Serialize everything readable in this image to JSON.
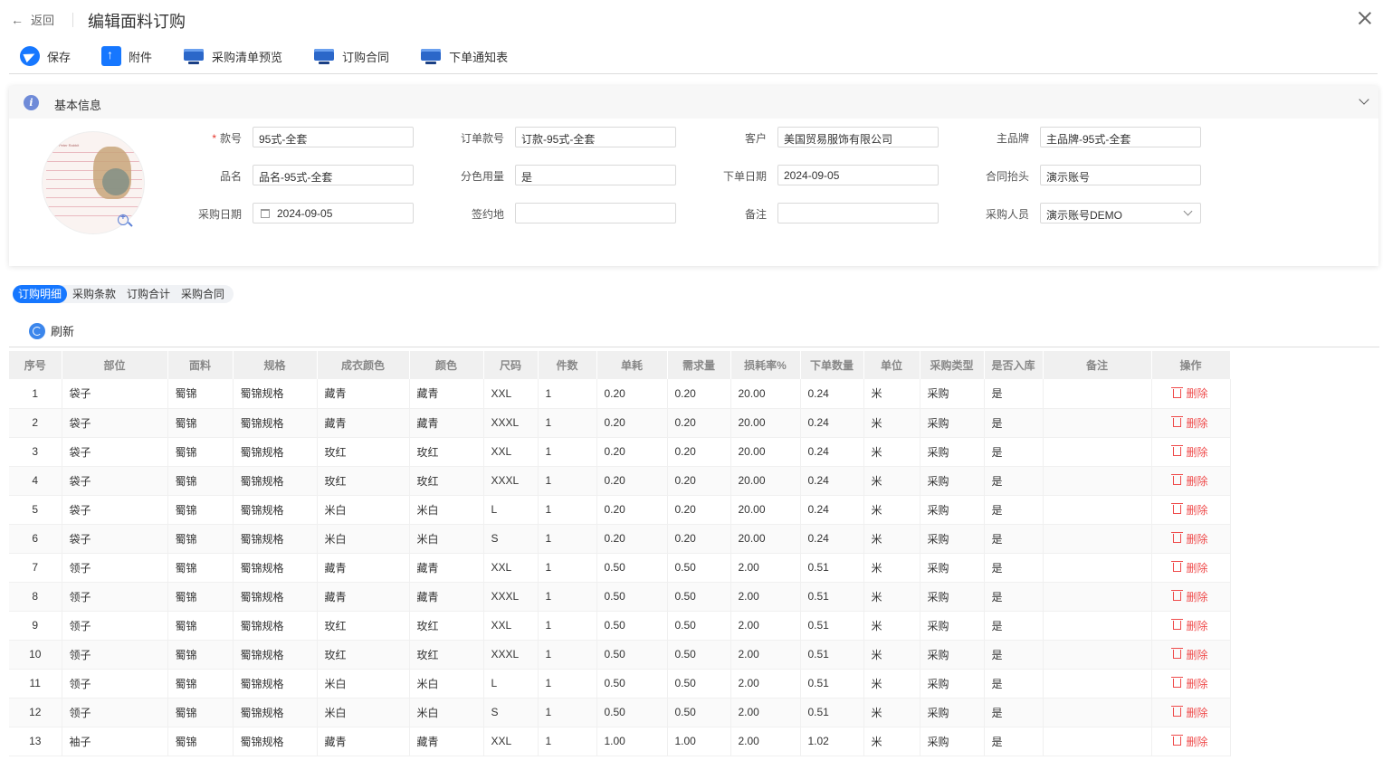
{
  "header": {
    "back_label": "返回",
    "title": "编辑面料订购"
  },
  "toolbar": {
    "save": "保存",
    "attachment": "附件",
    "purchase_list_preview": "采购清单预览",
    "order_contract": "订购合同",
    "order_notice": "下单通知表"
  },
  "panel": {
    "title": "基本信息",
    "thumbnail_text": "Peter Rabbit",
    "fields": {
      "style_no": {
        "label": "款号",
        "value": "95式-全套"
      },
      "order_style_no": {
        "label": "订单款号",
        "value": "订款-95式-全套"
      },
      "customer": {
        "label": "客户",
        "value": "美国贸易服饰有限公司"
      },
      "main_brand": {
        "label": "主品牌",
        "value": "主品牌-95式-全套"
      },
      "product_name": {
        "label": "品名",
        "value": "品名-95式-全套"
      },
      "color_usage": {
        "label": "分色用量",
        "value": "是"
      },
      "order_date": {
        "label": "下单日期",
        "value": "2024-09-05"
      },
      "contract_header": {
        "label": "合同抬头",
        "value": "演示账号"
      },
      "purchase_date": {
        "label": "采购日期",
        "value": "2024-09-05"
      },
      "sign_place": {
        "label": "签约地",
        "value": ""
      },
      "remark": {
        "label": "备注",
        "value": ""
      },
      "buyer": {
        "label": "采购人员",
        "value": "演示账号DEMO"
      }
    }
  },
  "tabs": [
    "订购明细",
    "采购条款",
    "订购合计",
    "采购合同"
  ],
  "refresh_label": "刷新",
  "table": {
    "columns": [
      "序号",
      "部位",
      "面料",
      "规格",
      "成衣颜色",
      "颜色",
      "尺码",
      "件数",
      "单耗",
      "需求量",
      "损耗率%",
      "下单数量",
      "单位",
      "采购类型",
      "是否入库",
      "备注",
      "操作"
    ],
    "delete_label": "删除",
    "rows": [
      [
        "1",
        "袋子",
        "蜀锦",
        "蜀锦规格",
        "藏青",
        "藏青",
        "XXL",
        "1",
        "0.20",
        "0.20",
        "20.00",
        "0.24",
        "米",
        "采购",
        "是",
        ""
      ],
      [
        "2",
        "袋子",
        "蜀锦",
        "蜀锦规格",
        "藏青",
        "藏青",
        "XXXL",
        "1",
        "0.20",
        "0.20",
        "20.00",
        "0.24",
        "米",
        "采购",
        "是",
        ""
      ],
      [
        "3",
        "袋子",
        "蜀锦",
        "蜀锦规格",
        "玫红",
        "玫红",
        "XXL",
        "1",
        "0.20",
        "0.20",
        "20.00",
        "0.24",
        "米",
        "采购",
        "是",
        ""
      ],
      [
        "4",
        "袋子",
        "蜀锦",
        "蜀锦规格",
        "玫红",
        "玫红",
        "XXXL",
        "1",
        "0.20",
        "0.20",
        "20.00",
        "0.24",
        "米",
        "采购",
        "是",
        ""
      ],
      [
        "5",
        "袋子",
        "蜀锦",
        "蜀锦规格",
        "米白",
        "米白",
        "L",
        "1",
        "0.20",
        "0.20",
        "20.00",
        "0.24",
        "米",
        "采购",
        "是",
        ""
      ],
      [
        "6",
        "袋子",
        "蜀锦",
        "蜀锦规格",
        "米白",
        "米白",
        "S",
        "1",
        "0.20",
        "0.20",
        "20.00",
        "0.24",
        "米",
        "采购",
        "是",
        ""
      ],
      [
        "7",
        "领子",
        "蜀锦",
        "蜀锦规格",
        "藏青",
        "藏青",
        "XXL",
        "1",
        "0.50",
        "0.50",
        "2.00",
        "0.51",
        "米",
        "采购",
        "是",
        ""
      ],
      [
        "8",
        "领子",
        "蜀锦",
        "蜀锦规格",
        "藏青",
        "藏青",
        "XXXL",
        "1",
        "0.50",
        "0.50",
        "2.00",
        "0.51",
        "米",
        "采购",
        "是",
        ""
      ],
      [
        "9",
        "领子",
        "蜀锦",
        "蜀锦规格",
        "玫红",
        "玫红",
        "XXL",
        "1",
        "0.50",
        "0.50",
        "2.00",
        "0.51",
        "米",
        "采购",
        "是",
        ""
      ],
      [
        "10",
        "领子",
        "蜀锦",
        "蜀锦规格",
        "玫红",
        "玫红",
        "XXXL",
        "1",
        "0.50",
        "0.50",
        "2.00",
        "0.51",
        "米",
        "采购",
        "是",
        ""
      ],
      [
        "11",
        "领子",
        "蜀锦",
        "蜀锦规格",
        "米白",
        "米白",
        "L",
        "1",
        "0.50",
        "0.50",
        "2.00",
        "0.51",
        "米",
        "采购",
        "是",
        ""
      ],
      [
        "12",
        "领子",
        "蜀锦",
        "蜀锦规格",
        "米白",
        "米白",
        "S",
        "1",
        "0.50",
        "0.50",
        "2.00",
        "0.51",
        "米",
        "采购",
        "是",
        ""
      ],
      [
        "13",
        "袖子",
        "蜀锦",
        "蜀锦规格",
        "藏青",
        "藏青",
        "XXL",
        "1",
        "1.00",
        "1.00",
        "2.00",
        "1.02",
        "米",
        "采购",
        "是",
        ""
      ]
    ]
  }
}
